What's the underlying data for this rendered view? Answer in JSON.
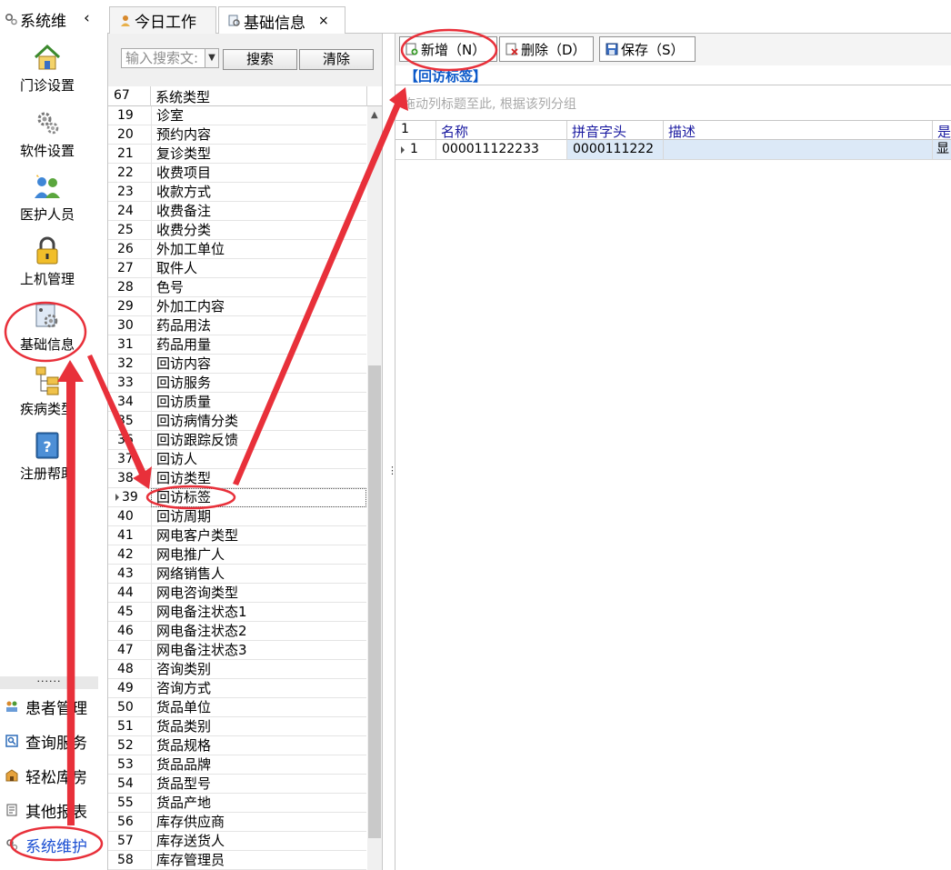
{
  "nav": {
    "title": "系统维",
    "collapse_icon": "chevron-left-icon",
    "items": [
      {
        "label": "门诊设置",
        "icon": "house-icon"
      },
      {
        "label": "软件设置",
        "icon": "gears-icon"
      },
      {
        "label": "医护人员",
        "icon": "people-icon"
      },
      {
        "label": "上机管理",
        "icon": "lock-icon"
      },
      {
        "label": "基础信息",
        "icon": "settings-box-icon"
      },
      {
        "label": "疾病类型",
        "icon": "tree-icon"
      },
      {
        "label": "注册帮助",
        "icon": "help-book-icon"
      }
    ],
    "dots": "......",
    "groups": [
      {
        "label": "患者管理",
        "icon": "patients-icon"
      },
      {
        "label": "查询服务",
        "icon": "query-icon"
      },
      {
        "label": "轻松库房",
        "icon": "warehouse-icon"
      },
      {
        "label": "其他报表",
        "icon": "report-icon"
      },
      {
        "label": "系统维护",
        "icon": "system-gear-icon"
      }
    ]
  },
  "tabs": [
    {
      "label": "今日工作",
      "icon": "person-icon"
    },
    {
      "label": "基础信息",
      "icon": "gear-doc-icon",
      "close": "×"
    }
  ],
  "search": {
    "placeholder": "输入搜索文:",
    "search_label": "搜索",
    "clear_label": "清除"
  },
  "list": {
    "header_count": "67",
    "header_name": "系统类型",
    "rows": [
      {
        "num": "19",
        "name": "诊室"
      },
      {
        "num": "20",
        "name": "预约内容"
      },
      {
        "num": "21",
        "name": "复诊类型"
      },
      {
        "num": "22",
        "name": "收费项目"
      },
      {
        "num": "23",
        "name": "收款方式"
      },
      {
        "num": "24",
        "name": "收费备注"
      },
      {
        "num": "25",
        "name": "收费分类"
      },
      {
        "num": "26",
        "name": "外加工单位"
      },
      {
        "num": "27",
        "name": "取件人"
      },
      {
        "num": "28",
        "name": "色号"
      },
      {
        "num": "29",
        "name": "外加工内容"
      },
      {
        "num": "30",
        "name": "药品用法"
      },
      {
        "num": "31",
        "name": "药品用量"
      },
      {
        "num": "32",
        "name": "回访内容"
      },
      {
        "num": "33",
        "name": "回访服务"
      },
      {
        "num": "34",
        "name": "回访质量"
      },
      {
        "num": "35",
        "name": "回访病情分类"
      },
      {
        "num": "36",
        "name": "回访跟踪反馈"
      },
      {
        "num": "37",
        "name": "回访人"
      },
      {
        "num": "38",
        "name": "回访类型"
      },
      {
        "num": "39",
        "name": "回访标签"
      },
      {
        "num": "40",
        "name": "回访周期"
      },
      {
        "num": "41",
        "name": "网电客户类型"
      },
      {
        "num": "42",
        "name": "网电推广人"
      },
      {
        "num": "43",
        "name": "网络销售人"
      },
      {
        "num": "44",
        "name": "网电咨询类型"
      },
      {
        "num": "45",
        "name": "网电备注状态1"
      },
      {
        "num": "46",
        "name": "网电备注状态2"
      },
      {
        "num": "47",
        "name": "网电备注状态3"
      },
      {
        "num": "48",
        "name": "咨询类别"
      },
      {
        "num": "49",
        "name": "咨询方式"
      },
      {
        "num": "50",
        "name": "货品单位"
      },
      {
        "num": "51",
        "name": "货品类别"
      },
      {
        "num": "52",
        "name": "货品规格"
      },
      {
        "num": "53",
        "name": "货品品牌"
      },
      {
        "num": "54",
        "name": "货品型号"
      },
      {
        "num": "55",
        "name": "货品产地"
      },
      {
        "num": "56",
        "name": "库存供应商"
      },
      {
        "num": "57",
        "name": "库存送货人"
      },
      {
        "num": "58",
        "name": "库存管理员"
      }
    ],
    "selected_num": "39"
  },
  "toolbar": {
    "add_label": "新增（N）",
    "delete_label": "删除（D）",
    "save_label": "保存（S）"
  },
  "detail": {
    "section_title": "【回访标签】",
    "group_hint": "拖动列标题至此, 根据该列分组",
    "columns": [
      "1",
      "名称",
      "拼音字头",
      "描述",
      "是"
    ],
    "rows": [
      {
        "num": "1",
        "name": "000011122233",
        "pinyin": "0000111222",
        "desc": "",
        "flag": "显"
      }
    ]
  },
  "colors": {
    "annotation": "#e8303a",
    "section_title": "#0a58c9",
    "header_text": "#1a1aa0",
    "selected_row": "#dce9f7"
  }
}
